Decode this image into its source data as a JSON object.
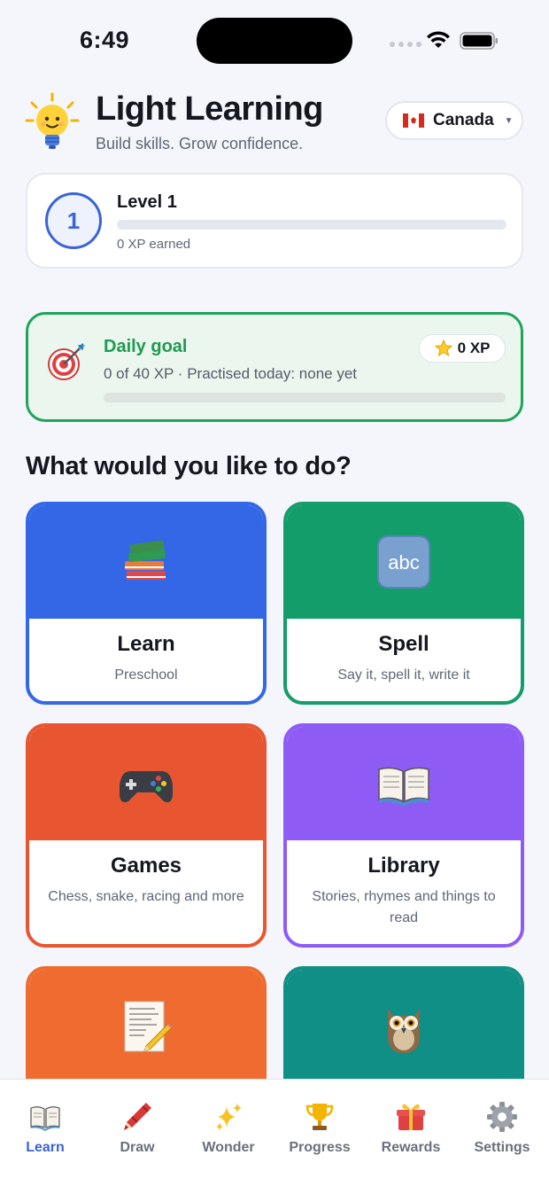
{
  "status_bar": {
    "time": "6:49"
  },
  "header": {
    "title": "Light Learning",
    "subtitle": "Build skills. Grow confidence.",
    "country": "Canada"
  },
  "level": {
    "number": "1",
    "title": "Level 1",
    "xp_text": "0 XP earned",
    "progress": 0
  },
  "daily_goal": {
    "title": "Daily goal",
    "subtitle": "0 of 40 XP  ·  Practised today: none yet",
    "xp_badge": "0 XP",
    "progress": 0
  },
  "section_title": "What would you like to do?",
  "tiles": [
    {
      "label": "Learn",
      "sub": "Preschool",
      "color": "#3367e6",
      "icon": "books-icon"
    },
    {
      "label": "Spell",
      "sub": "Say it, spell it, write it",
      "color": "#139d6a",
      "icon": "abc-icon"
    },
    {
      "label": "Games",
      "sub": "Chess, snake, racing and more",
      "color": "#e85631",
      "icon": "gamepad-icon"
    },
    {
      "label": "Library",
      "sub": "Stories, rhymes and things to read",
      "color": "#8e5cf5",
      "icon": "open-book-icon"
    },
    {
      "label": "",
      "sub": "",
      "color": "#ef6b2f",
      "icon": "memo-icon"
    },
    {
      "label": "",
      "sub": "",
      "color": "#0f8f86",
      "icon": "owl-icon"
    }
  ],
  "tabs": [
    {
      "label": "Learn",
      "icon": "book-icon",
      "active": true
    },
    {
      "label": "Draw",
      "icon": "crayon-icon"
    },
    {
      "label": "Wonder",
      "icon": "sparkles-icon"
    },
    {
      "label": "Progress",
      "icon": "trophy-icon"
    },
    {
      "label": "Rewards",
      "icon": "gift-icon"
    },
    {
      "label": "Settings",
      "icon": "gear-icon"
    }
  ]
}
